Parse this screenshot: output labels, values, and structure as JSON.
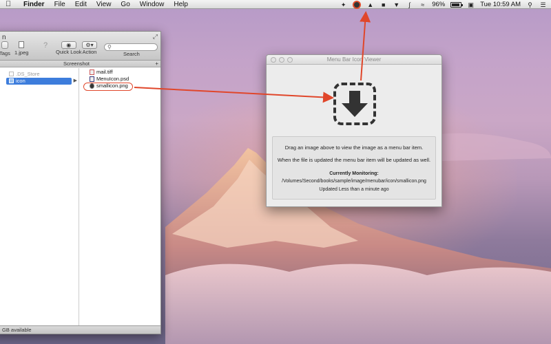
{
  "menubar": {
    "apple_icon": "apple-icon",
    "items": [
      "Finder",
      "File",
      "Edit",
      "View",
      "Go",
      "Window",
      "Help"
    ],
    "battery_percent": "96%",
    "clock": "Tue 10:59 AM",
    "status_icons": [
      "wing-icon",
      "menu-bar-item-icon",
      "hat-icon",
      "lock-icon",
      "pin-icon",
      "bluetooth-icon",
      "wifi-icon",
      "battery-icon",
      "user-icon",
      "spotlight-icon",
      "list-icon"
    ]
  },
  "finder": {
    "title": "n",
    "toolbar": {
      "tags_label": "Tags",
      "file_label": "1.jpeg",
      "quicklook_label": "Quick Look",
      "action_label": "Action",
      "search_label": "Search"
    },
    "path_title": "Screenshot",
    "column1": [
      {
        "name": ".DS_Store",
        "dim": true
      },
      {
        "name": "icon",
        "selected": true
      }
    ],
    "column2": [
      {
        "name": "mail.tiff"
      },
      {
        "name": "MenuIcon.psd"
      },
      {
        "name": "smallicon.png"
      }
    ],
    "status": "GB available"
  },
  "viewer": {
    "title": "Menu Bar Icon Viewer",
    "drop_icon": "download-arrow-icon",
    "line1": "Drag an image above to view the image as a menu bar item.",
    "line2": "When the file is updated the menu bar item will be updated as well.",
    "monitoring_label": "Currently Monitoring:",
    "path": "/Volumes/Second/books/sample/image/menubar/icon/smallicon.png",
    "updated": "Updated Less than a minute ago"
  },
  "colors": {
    "annotation": "#e0462a",
    "selection": "#3d7ddc"
  }
}
